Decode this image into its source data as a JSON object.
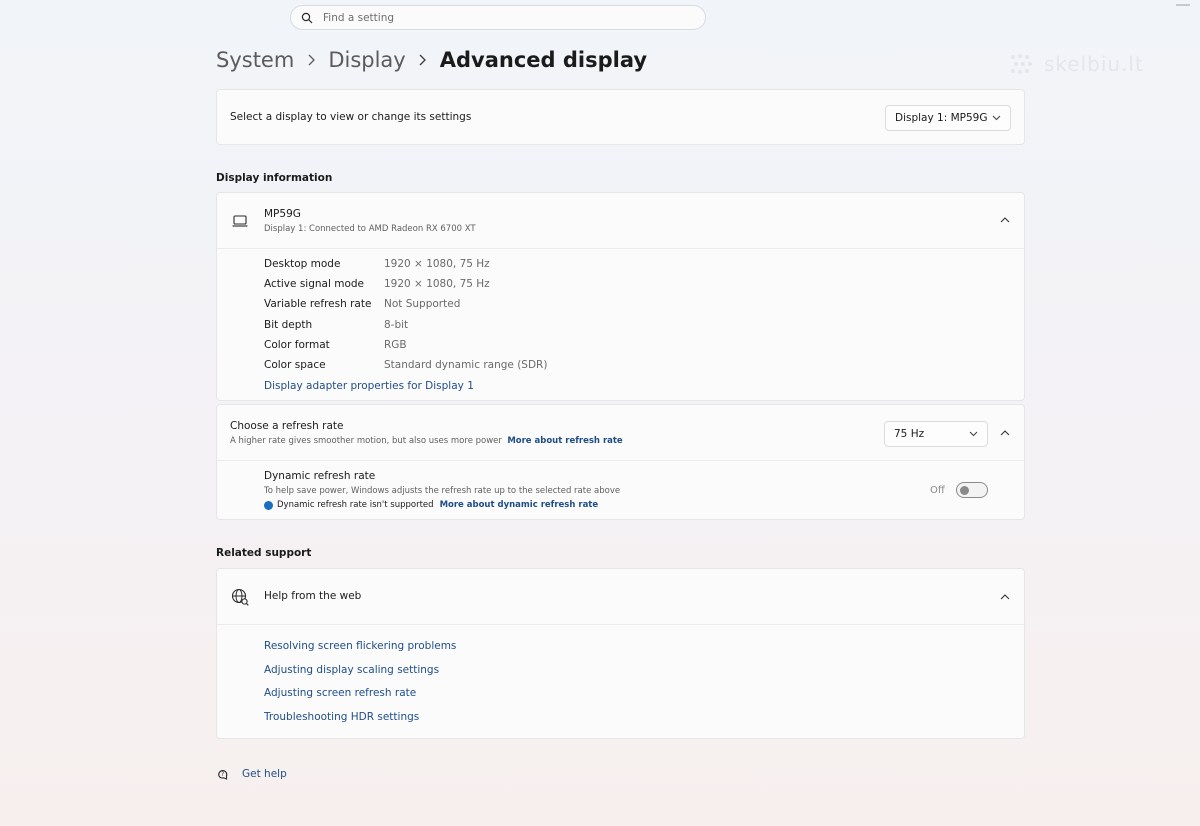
{
  "search": {
    "placeholder": "Find a setting"
  },
  "breadcrumb": {
    "items": [
      "System",
      "Display"
    ],
    "current": "Advanced display"
  },
  "watermark": {
    "text": "skelbiu.lt"
  },
  "select_display": {
    "label": "Select a display to view or change its settings",
    "selected": "Display 1: MP59G"
  },
  "display_information": {
    "section_title": "Display information",
    "monitor_name": "MP59G",
    "monitor_sub": "Display 1: Connected to AMD Radeon RX 6700 XT",
    "rows": [
      {
        "key": "Desktop mode",
        "value": "1920 × 1080, 75 Hz"
      },
      {
        "key": "Active signal mode",
        "value": "1920 × 1080, 75 Hz"
      },
      {
        "key": "Variable refresh rate",
        "value": "Not Supported"
      },
      {
        "key": "Bit depth",
        "value": "8-bit"
      },
      {
        "key": "Color format",
        "value": "RGB"
      },
      {
        "key": "Color space",
        "value": "Standard dynamic range (SDR)"
      }
    ],
    "adapter_link": "Display adapter properties for Display 1"
  },
  "refresh_rate": {
    "title": "Choose a refresh rate",
    "description": "A higher rate gives smoother motion, but also uses more power",
    "more_link": "More about refresh rate",
    "selected": "75 Hz",
    "dynamic": {
      "title": "Dynamic refresh rate",
      "description": "To help save power, Windows adjusts the refresh rate up to the selected rate above",
      "not_supported": "Dynamic refresh rate isn't supported",
      "more_link": "More about dynamic refresh rate",
      "toggle_state": "Off"
    }
  },
  "related_support": {
    "section_title": "Related support",
    "help_title": "Help from the web",
    "links": [
      "Resolving screen flickering problems",
      "Adjusting display scaling settings",
      "Adjusting screen refresh rate",
      "Troubleshooting HDR settings"
    ]
  },
  "get_help": {
    "label": "Get help"
  },
  "colors": {
    "accent": "#1a6fc1",
    "link": "#1f4d88"
  }
}
